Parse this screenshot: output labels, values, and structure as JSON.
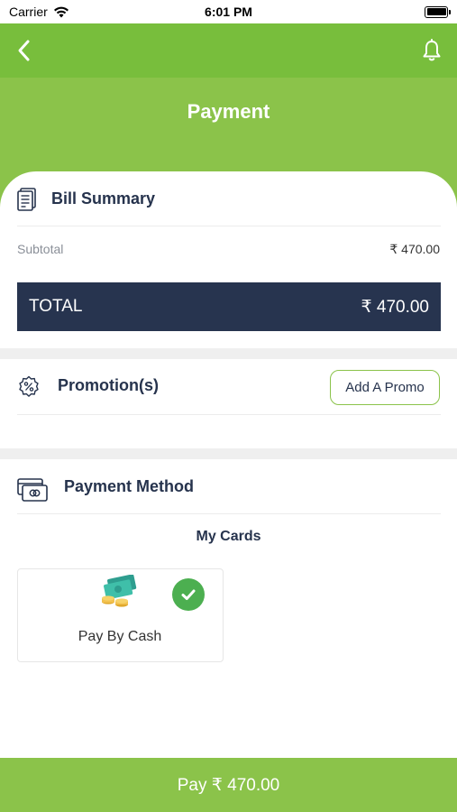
{
  "status_bar": {
    "carrier": "Carrier",
    "time": "6:01 PM"
  },
  "header": {
    "title": "Payment",
    "back_icon": "chevron-left-icon",
    "bell_icon": "bell-icon"
  },
  "bill_summary": {
    "title": "Bill Summary",
    "icon": "receipt-icon",
    "subtotal_label": "Subtotal",
    "subtotal_value": "₹ 470.00",
    "total_label": "TOTAL",
    "total_value": "₹ 470.00"
  },
  "promotions": {
    "title": "Promotion(s)",
    "icon": "discount-badge-icon",
    "add_promo_label": "Add A Promo"
  },
  "payment_method": {
    "title": "Payment Method",
    "icon": "card-icon",
    "my_cards_label": "My Cards",
    "options": [
      {
        "label": "Pay By Cash",
        "icon": "cash-icon",
        "selected": true
      }
    ]
  },
  "footer": {
    "pay_label": "Pay ₹ 470.00"
  },
  "colors": {
    "brand_green": "#8bc34a",
    "navbar_green": "#78be3c",
    "total_bar": "#27344f",
    "check_green": "#4caf50"
  }
}
